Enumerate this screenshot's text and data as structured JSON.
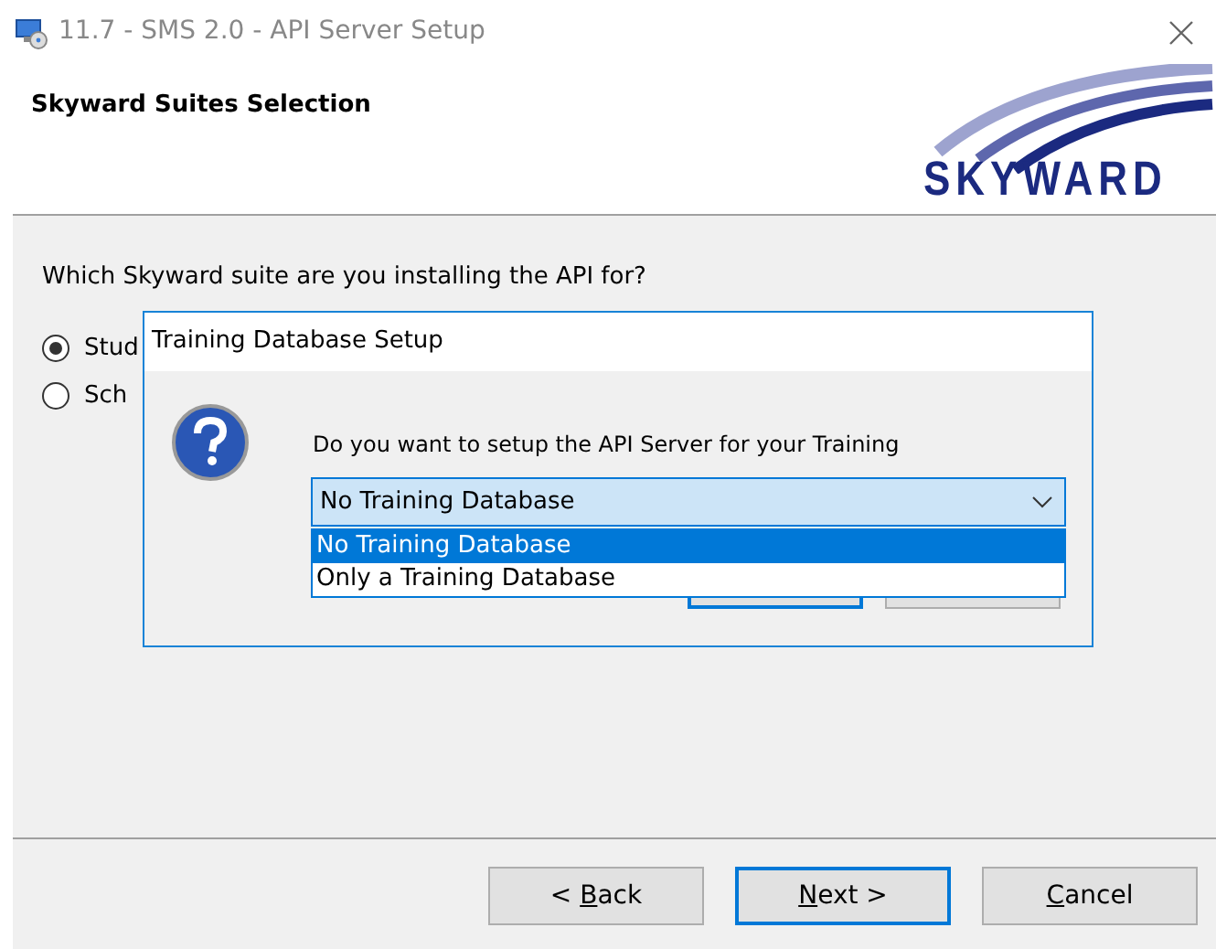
{
  "window": {
    "title": "11.7 - SMS 2.0 - API Server Setup"
  },
  "header": {
    "title": "Skyward Suites Selection",
    "logo_text": "SKYWARD"
  },
  "question": "Which Skyward suite are you installing the API for?",
  "options": [
    {
      "label": "Stud",
      "selected": true
    },
    {
      "label": "Sch",
      "selected": false
    }
  ],
  "buttons": [
    {
      "before": "< ",
      "key": "B",
      "after": "ack",
      "default": false
    },
    {
      "key": "N",
      "after": "ext >",
      "default": true
    },
    {
      "key": "C",
      "after": "ancel",
      "default": false
    }
  ],
  "dialog": {
    "title": "Training Database Setup",
    "message": "Do you want to setup the API Server for your Training",
    "combo": {
      "value": "No Training Database",
      "expanded": true
    },
    "list": [
      {
        "label": "No Training Database",
        "selected": true
      },
      {
        "label": "Only a Training Database",
        "selected": false
      }
    ]
  }
}
